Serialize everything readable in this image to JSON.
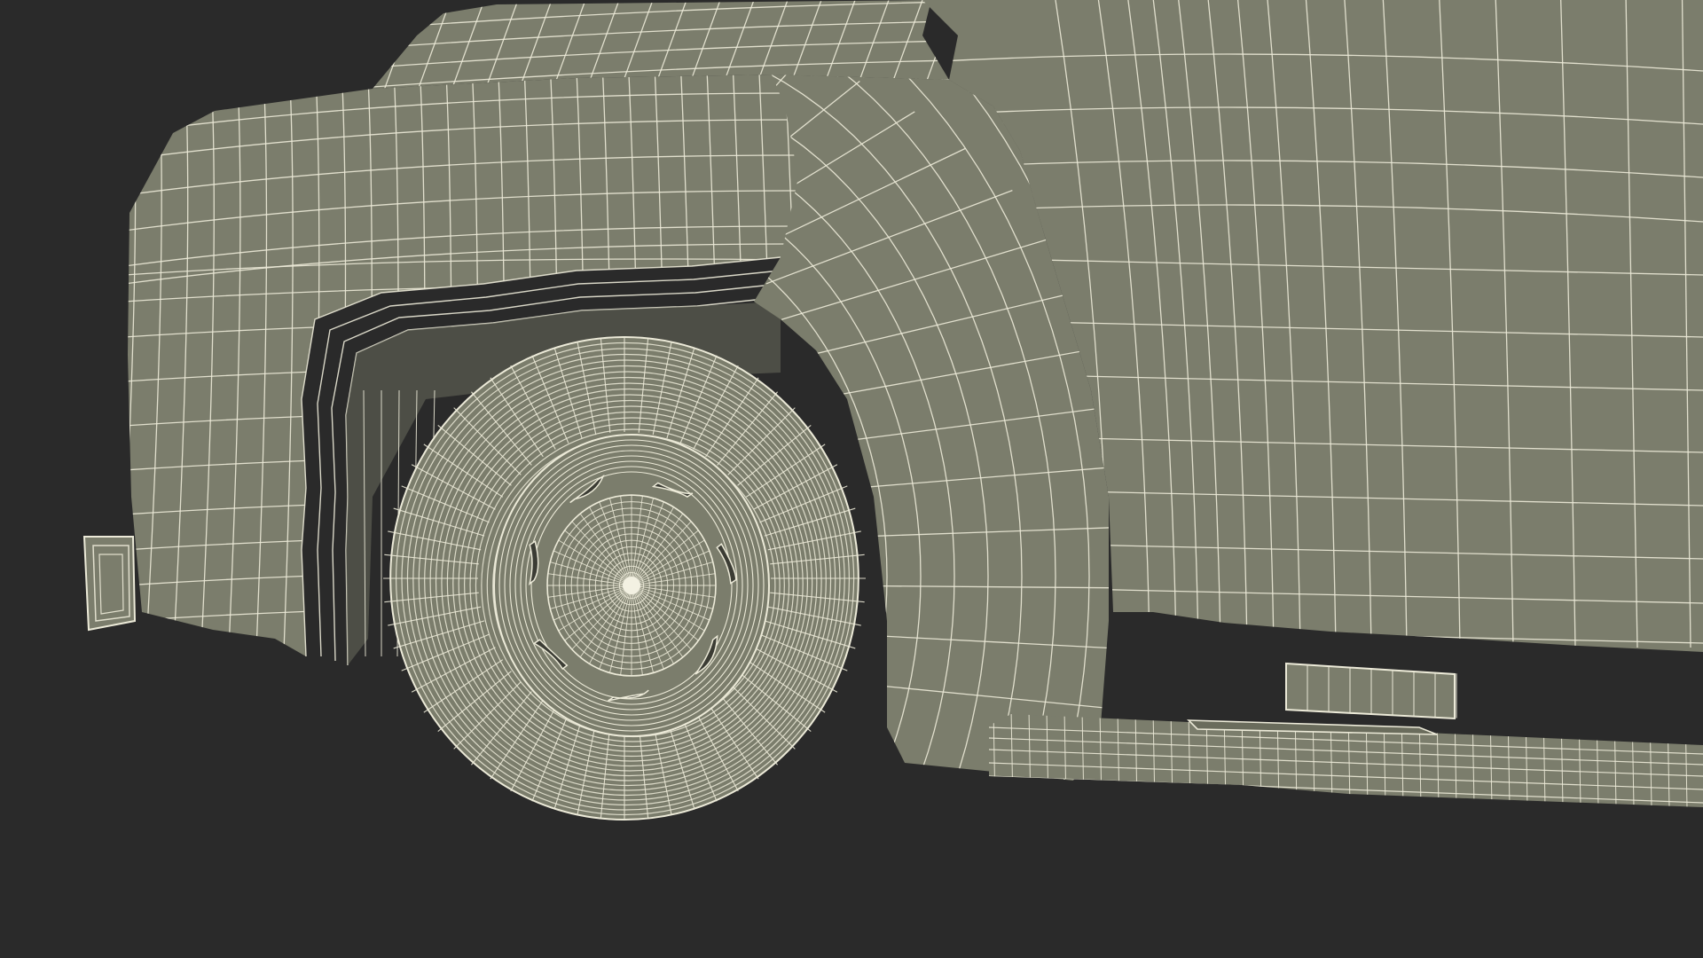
{
  "scene": {
    "background_color": "#2a2a2a",
    "surface_color": "#7b7d6c",
    "surface_shadow_color": "#6a6c5c",
    "wire_color": "#ecead8",
    "text": []
  },
  "wireframe": {
    "tire_rings": 18,
    "tire_spokes": 64,
    "hub_rings": 14,
    "hub_spokes": 48,
    "rim_slots": 7
  }
}
